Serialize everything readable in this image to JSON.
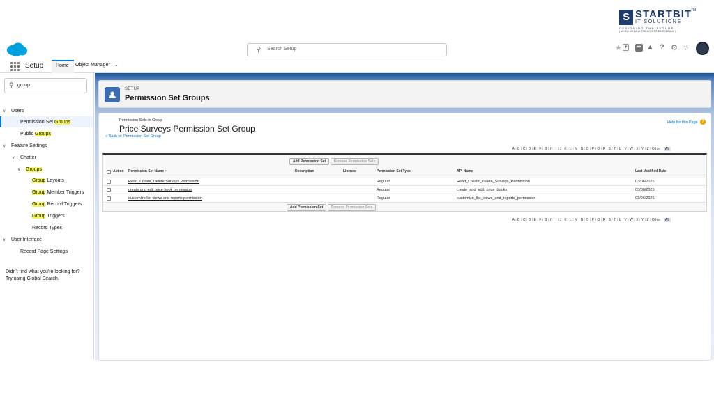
{
  "watermark": {
    "logo_letter": "S",
    "line1": "STARTBIT",
    "line2": "IT SOLUTIONS",
    "tagline": "DESIGNING THE FUTURE",
    "cert": "| AN ISO 9001 AND 27001 CERTIFIED COMPANY |",
    "tm": "TM"
  },
  "header": {
    "search_placeholder": "Search Setup",
    "icons": [
      "favorites-star-icon",
      "favorites-dropdown-icon",
      "global-actions-plus-icon",
      "trailhead-icon",
      "help-icon",
      "setup-gear-icon",
      "notifications-bell-icon",
      "user-avatar-icon"
    ]
  },
  "nav": {
    "app_name": "Setup",
    "tabs": [
      {
        "label": "Home"
      },
      {
        "label": "Object Manager"
      }
    ]
  },
  "sidebar": {
    "quick_find_value": "group",
    "items": [
      {
        "label": "Users",
        "prefix": "",
        "match": "",
        "suffix": ""
      },
      {
        "label": "",
        "prefix": "Permission Set ",
        "match": "Groups",
        "suffix": ""
      },
      {
        "label": "",
        "prefix": "Public ",
        "match": "Groups",
        "suffix": ""
      },
      {
        "label": "Feature Settings",
        "prefix": "",
        "match": "",
        "suffix": ""
      },
      {
        "label": "Chatter",
        "prefix": "",
        "match": "",
        "suffix": ""
      },
      {
        "label": "",
        "prefix": "",
        "match": "Groups",
        "suffix": ""
      },
      {
        "label": "",
        "prefix": "",
        "match": "Group",
        "suffix": " Layouts"
      },
      {
        "label": "",
        "prefix": "",
        "match": "Group",
        "suffix": " Member Triggers"
      },
      {
        "label": "",
        "prefix": "",
        "match": "Group",
        "suffix": " Record Triggers"
      },
      {
        "label": "",
        "prefix": "",
        "match": "Group",
        "suffix": " Triggers"
      },
      {
        "label": "Record Types",
        "prefix": "",
        "match": "",
        "suffix": ""
      },
      {
        "label": "User Interface",
        "prefix": "",
        "match": "",
        "suffix": ""
      },
      {
        "label": "Record Page Settings",
        "prefix": "",
        "match": "",
        "suffix": ""
      }
    ],
    "hint_line1": "Didn't find what you're looking for?",
    "hint_line2": "Try using Global Search."
  },
  "page_header": {
    "eyebrow": "SETUP",
    "title": "Permission Set Groups"
  },
  "detail": {
    "section_label": "Permission Sets in Group",
    "group_name": "Price Surveys Permission Set Group",
    "back_link": "« Back to: Permission Set Group",
    "help_link": "Help for this Page",
    "alphabet": [
      "A",
      "B",
      "C",
      "D",
      "E",
      "F",
      "G",
      "H",
      "I",
      "J",
      "K",
      "L",
      "M",
      "N",
      "O",
      "P",
      "Q",
      "R",
      "S",
      "T",
      "U",
      "V",
      "W",
      "X",
      "Y",
      "Z",
      "Other",
      "All"
    ],
    "add_button": "Add Permission Set",
    "remove_button": "Remove Permission Sets",
    "columns": [
      "Action",
      "Permission Set Name",
      "Description",
      "License",
      "Permission Set Type",
      "API Name",
      "Last Modified Date"
    ],
    "sort_indicator": "↑",
    "rows": [
      {
        "name": "Read, Create, Delete Surveys Permission",
        "description": "",
        "license": "",
        "type": "Regular",
        "api_name": "Read_Create_Delete_Surveys_Permission",
        "modified": "03/06/2025"
      },
      {
        "name": "create and edit price book permission",
        "description": "",
        "license": "",
        "type": "Regular",
        "api_name": "create_and_edit_price_books",
        "modified": "03/06/2025"
      },
      {
        "name": "customize list views and reports permission",
        "description": "",
        "license": "",
        "type": "Regular",
        "api_name": "customize_list_views_and_reports_permission",
        "modified": "03/06/2025"
      }
    ]
  },
  "colors": {
    "accent": "#0176d3",
    "highlight": "#f3f55a",
    "brand": "#1f3b6e"
  }
}
